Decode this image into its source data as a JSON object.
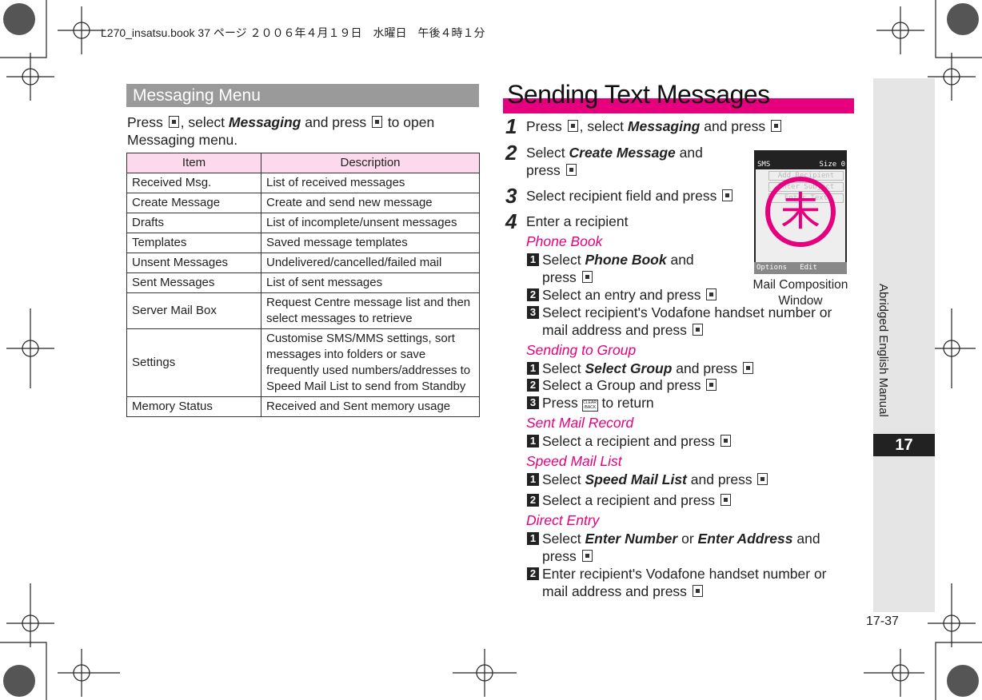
{
  "print_header": "L270_insatsu.book  37 ページ  ２００６年４月１９日　水曜日　午後４時１分",
  "left": {
    "heading": "Messaging Menu",
    "intro": [
      "Press ",
      ", select ",
      "Messaging",
      " and press ",
      " to open Messaging menu."
    ],
    "table": {
      "headers": [
        "Item",
        "Description"
      ],
      "rows": [
        [
          "Received Msg.",
          "List of received messages"
        ],
        [
          "Create Message",
          "Create and send new message"
        ],
        [
          "Drafts",
          "List of incomplete/unsent messages"
        ],
        [
          "Templates",
          "Saved message templates"
        ],
        [
          "Unsent Messages",
          "Undelivered/cancelled/failed mail"
        ],
        [
          "Sent Messages",
          "List of sent messages"
        ],
        [
          "Server Mail Box",
          "Request Centre message list and then select messages to retrieve"
        ],
        [
          "Settings",
          "Customise SMS/MMS settings, sort messages into folders or save frequently used numbers/addresses to Speed Mail List to send from Standby"
        ],
        [
          "Memory Status",
          "Received and Sent memory usage"
        ]
      ]
    }
  },
  "right": {
    "title": "Sending Text Messages",
    "steps": [
      {
        "n": "1",
        "a": "Press ",
        "b": ", select ",
        "c": "Messaging",
        "d": " and press "
      },
      {
        "n": "2",
        "a": "Select ",
        "c": "Create Message",
        "d": " and press "
      },
      {
        "n": "3",
        "a": "Select recipient field and press "
      },
      {
        "n": "4",
        "a": "Enter a recipient"
      }
    ],
    "phone_book": {
      "label": "Phone Book",
      "s1a": "Select ",
      "s1b": "Phone Book",
      "s1c": " and press ",
      "s2": "Select an entry and press ",
      "s3": "Select recipient's Vodafone handset number or mail address and press "
    },
    "group": {
      "label": "Sending to Group",
      "s1a": "Select ",
      "s1b": "Select Group",
      "s1c": " and press ",
      "s2": "Select a Group and press ",
      "s3a": "Press ",
      "s3b": " to return"
    },
    "sent": {
      "label": "Sent Mail Record",
      "s1": "Select a recipient and press "
    },
    "speed": {
      "label": "Speed Mail List",
      "s1a": "Select ",
      "s1b": "Speed Mail List",
      "s1c": " and press ",
      "s2": "Select a recipient and press "
    },
    "direct": {
      "label": "Direct Entry",
      "s1a": "Select ",
      "s1b": "Enter Number",
      "s1c": " or ",
      "s1d": "Enter Address",
      "s1e": " and press ",
      "s2": "Enter recipient's Vodafone handset number or mail address and press "
    },
    "screen": {
      "app": "SMS",
      "size": "Size 0",
      "fields": [
        "Add Recipient",
        "Enter Subject",
        "Enter Text"
      ],
      "soft": [
        "Options",
        "Edit"
      ],
      "stamp": "未",
      "caption": "Mail Composition Window"
    }
  },
  "sidebar": {
    "label": "Abridged English Manual",
    "chapter": "17"
  },
  "page_number": "17-37",
  "colors": {
    "accent": "#e6007e",
    "header_gray": "#9a9a9a",
    "table_head": "#fcd9ec"
  }
}
